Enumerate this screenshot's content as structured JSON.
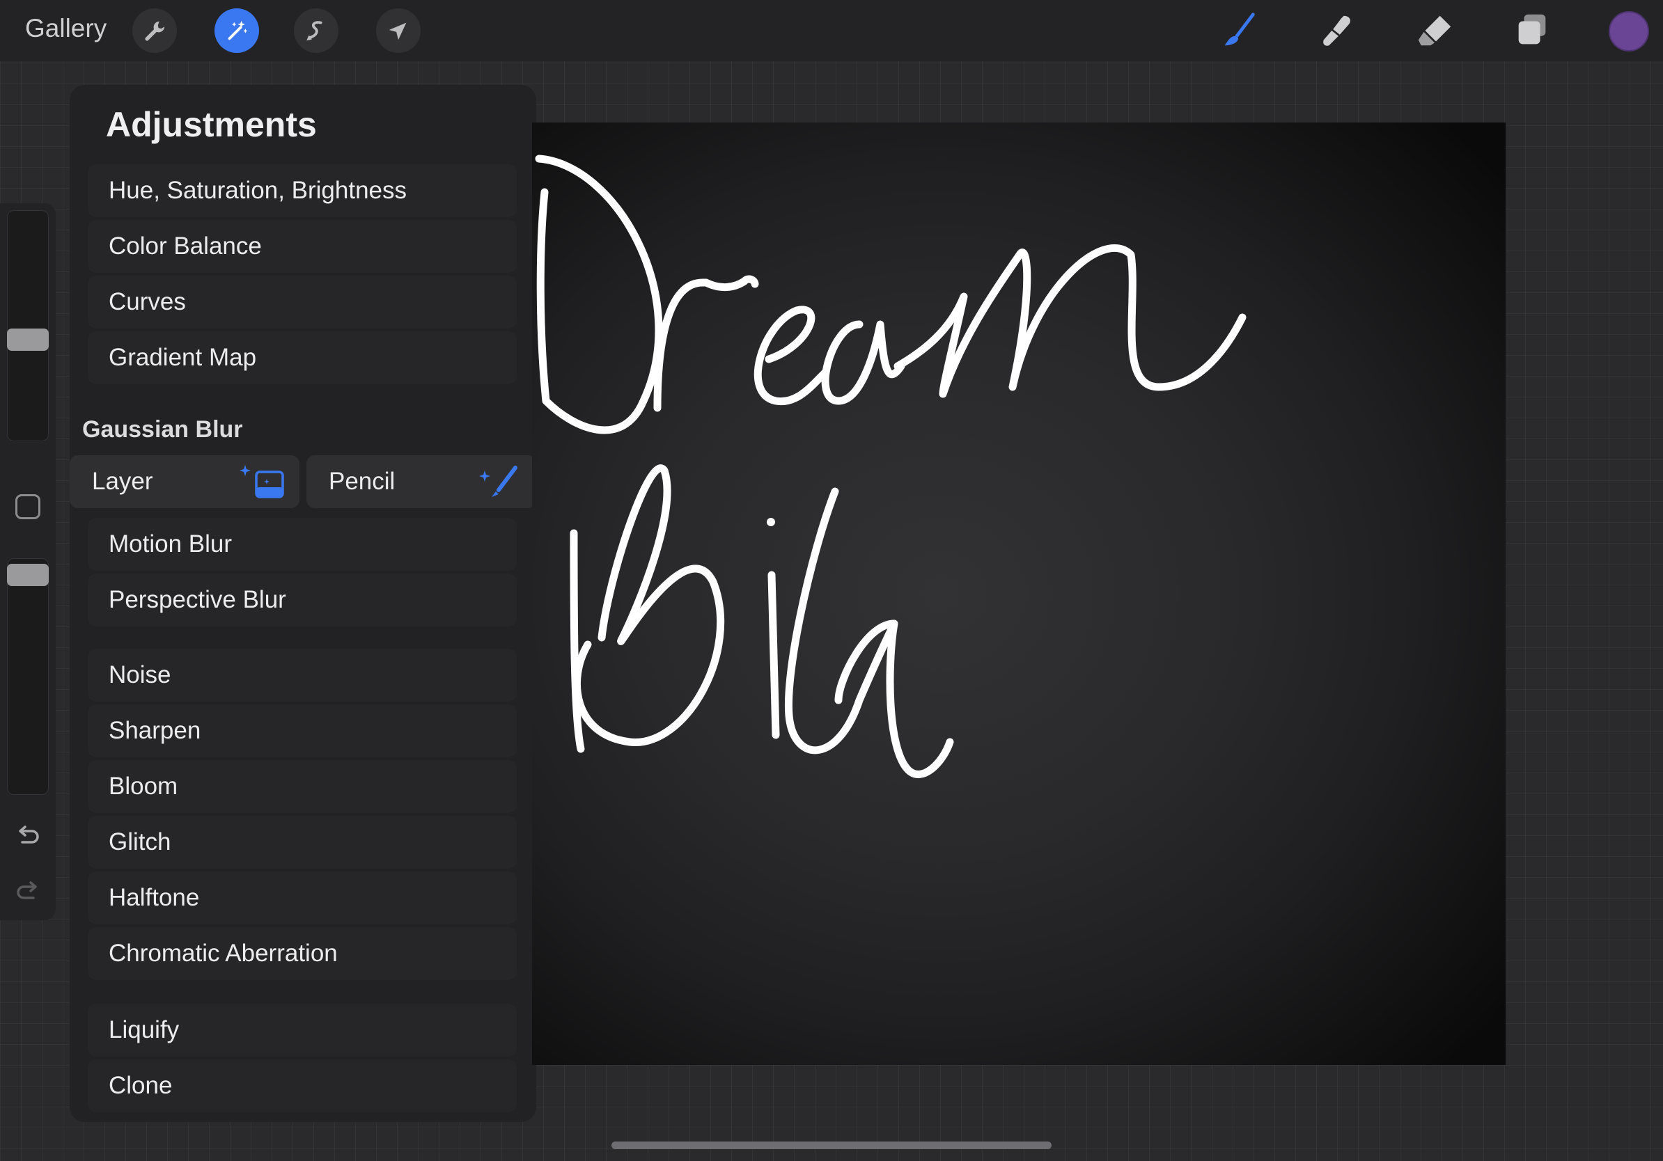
{
  "topbar": {
    "gallery_label": "Gallery",
    "left_tools": [
      {
        "icon": "wrench-icon",
        "name": "actions"
      },
      {
        "icon": "magic-wand-icon",
        "name": "adjustments",
        "active": true
      },
      {
        "icon": "selection-icon",
        "name": "selection"
      },
      {
        "icon": "arrow-cursor-icon",
        "name": "transform"
      }
    ],
    "right_tools": [
      {
        "icon": "brush-icon",
        "name": "paint",
        "active": true
      },
      {
        "icon": "smudge-icon",
        "name": "smudge"
      },
      {
        "icon": "eraser-icon",
        "name": "erase"
      },
      {
        "icon": "layers-icon",
        "name": "layers"
      }
    ],
    "current_color": "#6a4596",
    "accent_color": "#3a78f2"
  },
  "sidebar": {
    "brush_size_level": 0.55,
    "opacity_level": 0.95,
    "icons": [
      "modify-icon",
      "undo-icon",
      "redo-icon"
    ]
  },
  "adjustments": {
    "title": "Adjustments",
    "items_group1": [
      "Hue, Saturation, Brightness",
      "Color Balance",
      "Curves",
      "Gradient Map"
    ],
    "gaussian_blur": {
      "title": "Gaussian Blur",
      "layer_label": "Layer",
      "pencil_label": "Pencil"
    },
    "items_group2": [
      "Motion Blur",
      "Perspective Blur"
    ],
    "items_group3": [
      "Noise",
      "Sharpen",
      "Bloom",
      "Glitch",
      "Halftone",
      "Chromatic Aberration"
    ],
    "items_group4": [
      "Liquify",
      "Clone"
    ]
  }
}
